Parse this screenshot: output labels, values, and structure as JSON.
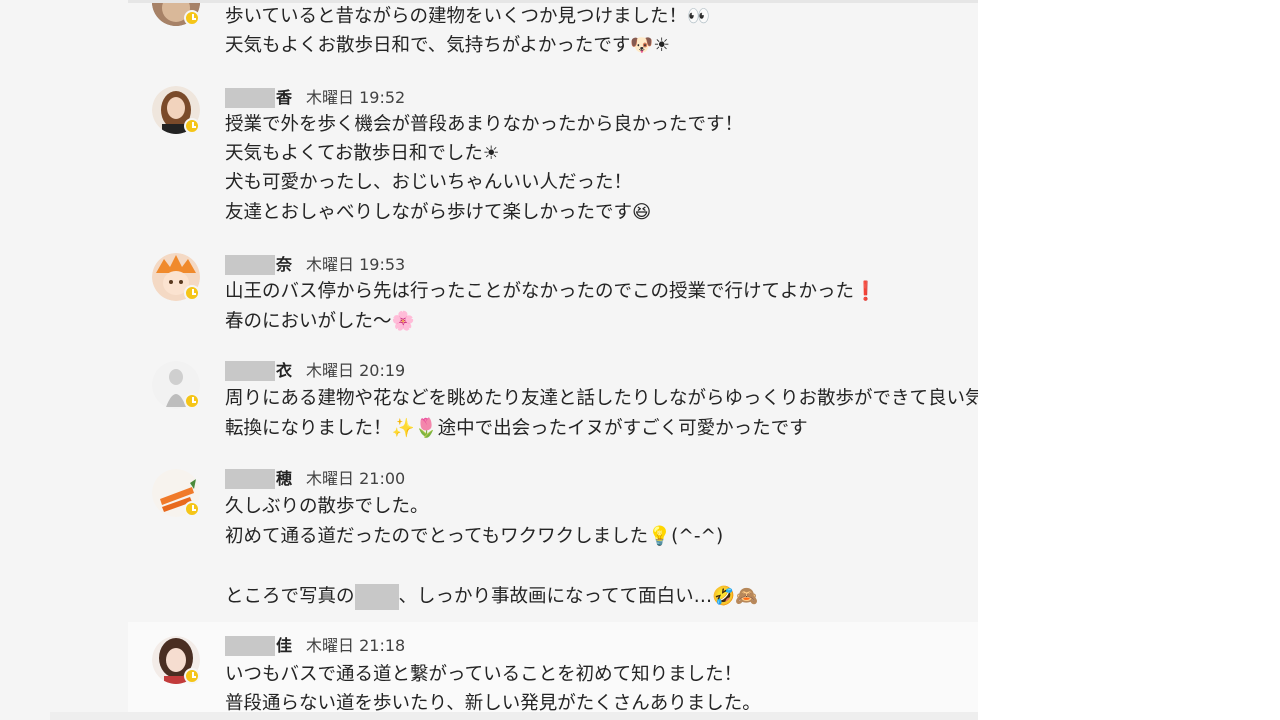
{
  "messages": [
    {
      "lines": [
        "歩いていると昔ながらの建物をいくつか見つけました！👀",
        "天気もよくお散歩日和で、気持ちがよかったです🐶☀"
      ]
    },
    {
      "name_tail": "香",
      "day": "木曜日",
      "time": "19:52",
      "lines": [
        "授業で外を歩く機会が普段あまりなかったから良かったです！",
        "天気もよくてお散歩日和でした☀",
        "犬も可愛かったし、おじいちゃんいい人だった！",
        "友達とおしゃべりしながら歩けて楽しかったです😆"
      ]
    },
    {
      "name_tail": "奈",
      "day": "木曜日",
      "time": "19:53",
      "lines": [
        "山王のバス停から先は行ったことがなかったのでこの授業で行けてよかった❗",
        "春のにおいがした〜🌸"
      ]
    },
    {
      "name_tail": "衣",
      "day": "木曜日",
      "time": "20:19",
      "lines": [
        "周りにある建物や花などを眺めたり友達と話したりしながらゆっくりお散歩ができて良い気分",
        "転換になりました！✨🌷途中で出会ったイヌがすごく可愛かったです"
      ]
    },
    {
      "name_tail": "穂",
      "day": "木曜日",
      "time": "21:00",
      "lines": [
        "久しぶりの散歩でした。",
        "初めて通る道だったのでとってもワクワクしました💡(^-^)"
      ],
      "last_line_pre": "ところで写真の",
      "last_line_post": "、しっかり事故画になってて面白い…🤣🙈"
    },
    {
      "name_tail": "佳",
      "day": "木曜日",
      "time": "21:18",
      "lines": [
        "いつもバスで通る道と繋がっていることを初めて知りました！",
        "普段通らない道を歩いたり、新しい発見がたくさんありました。"
      ]
    }
  ]
}
